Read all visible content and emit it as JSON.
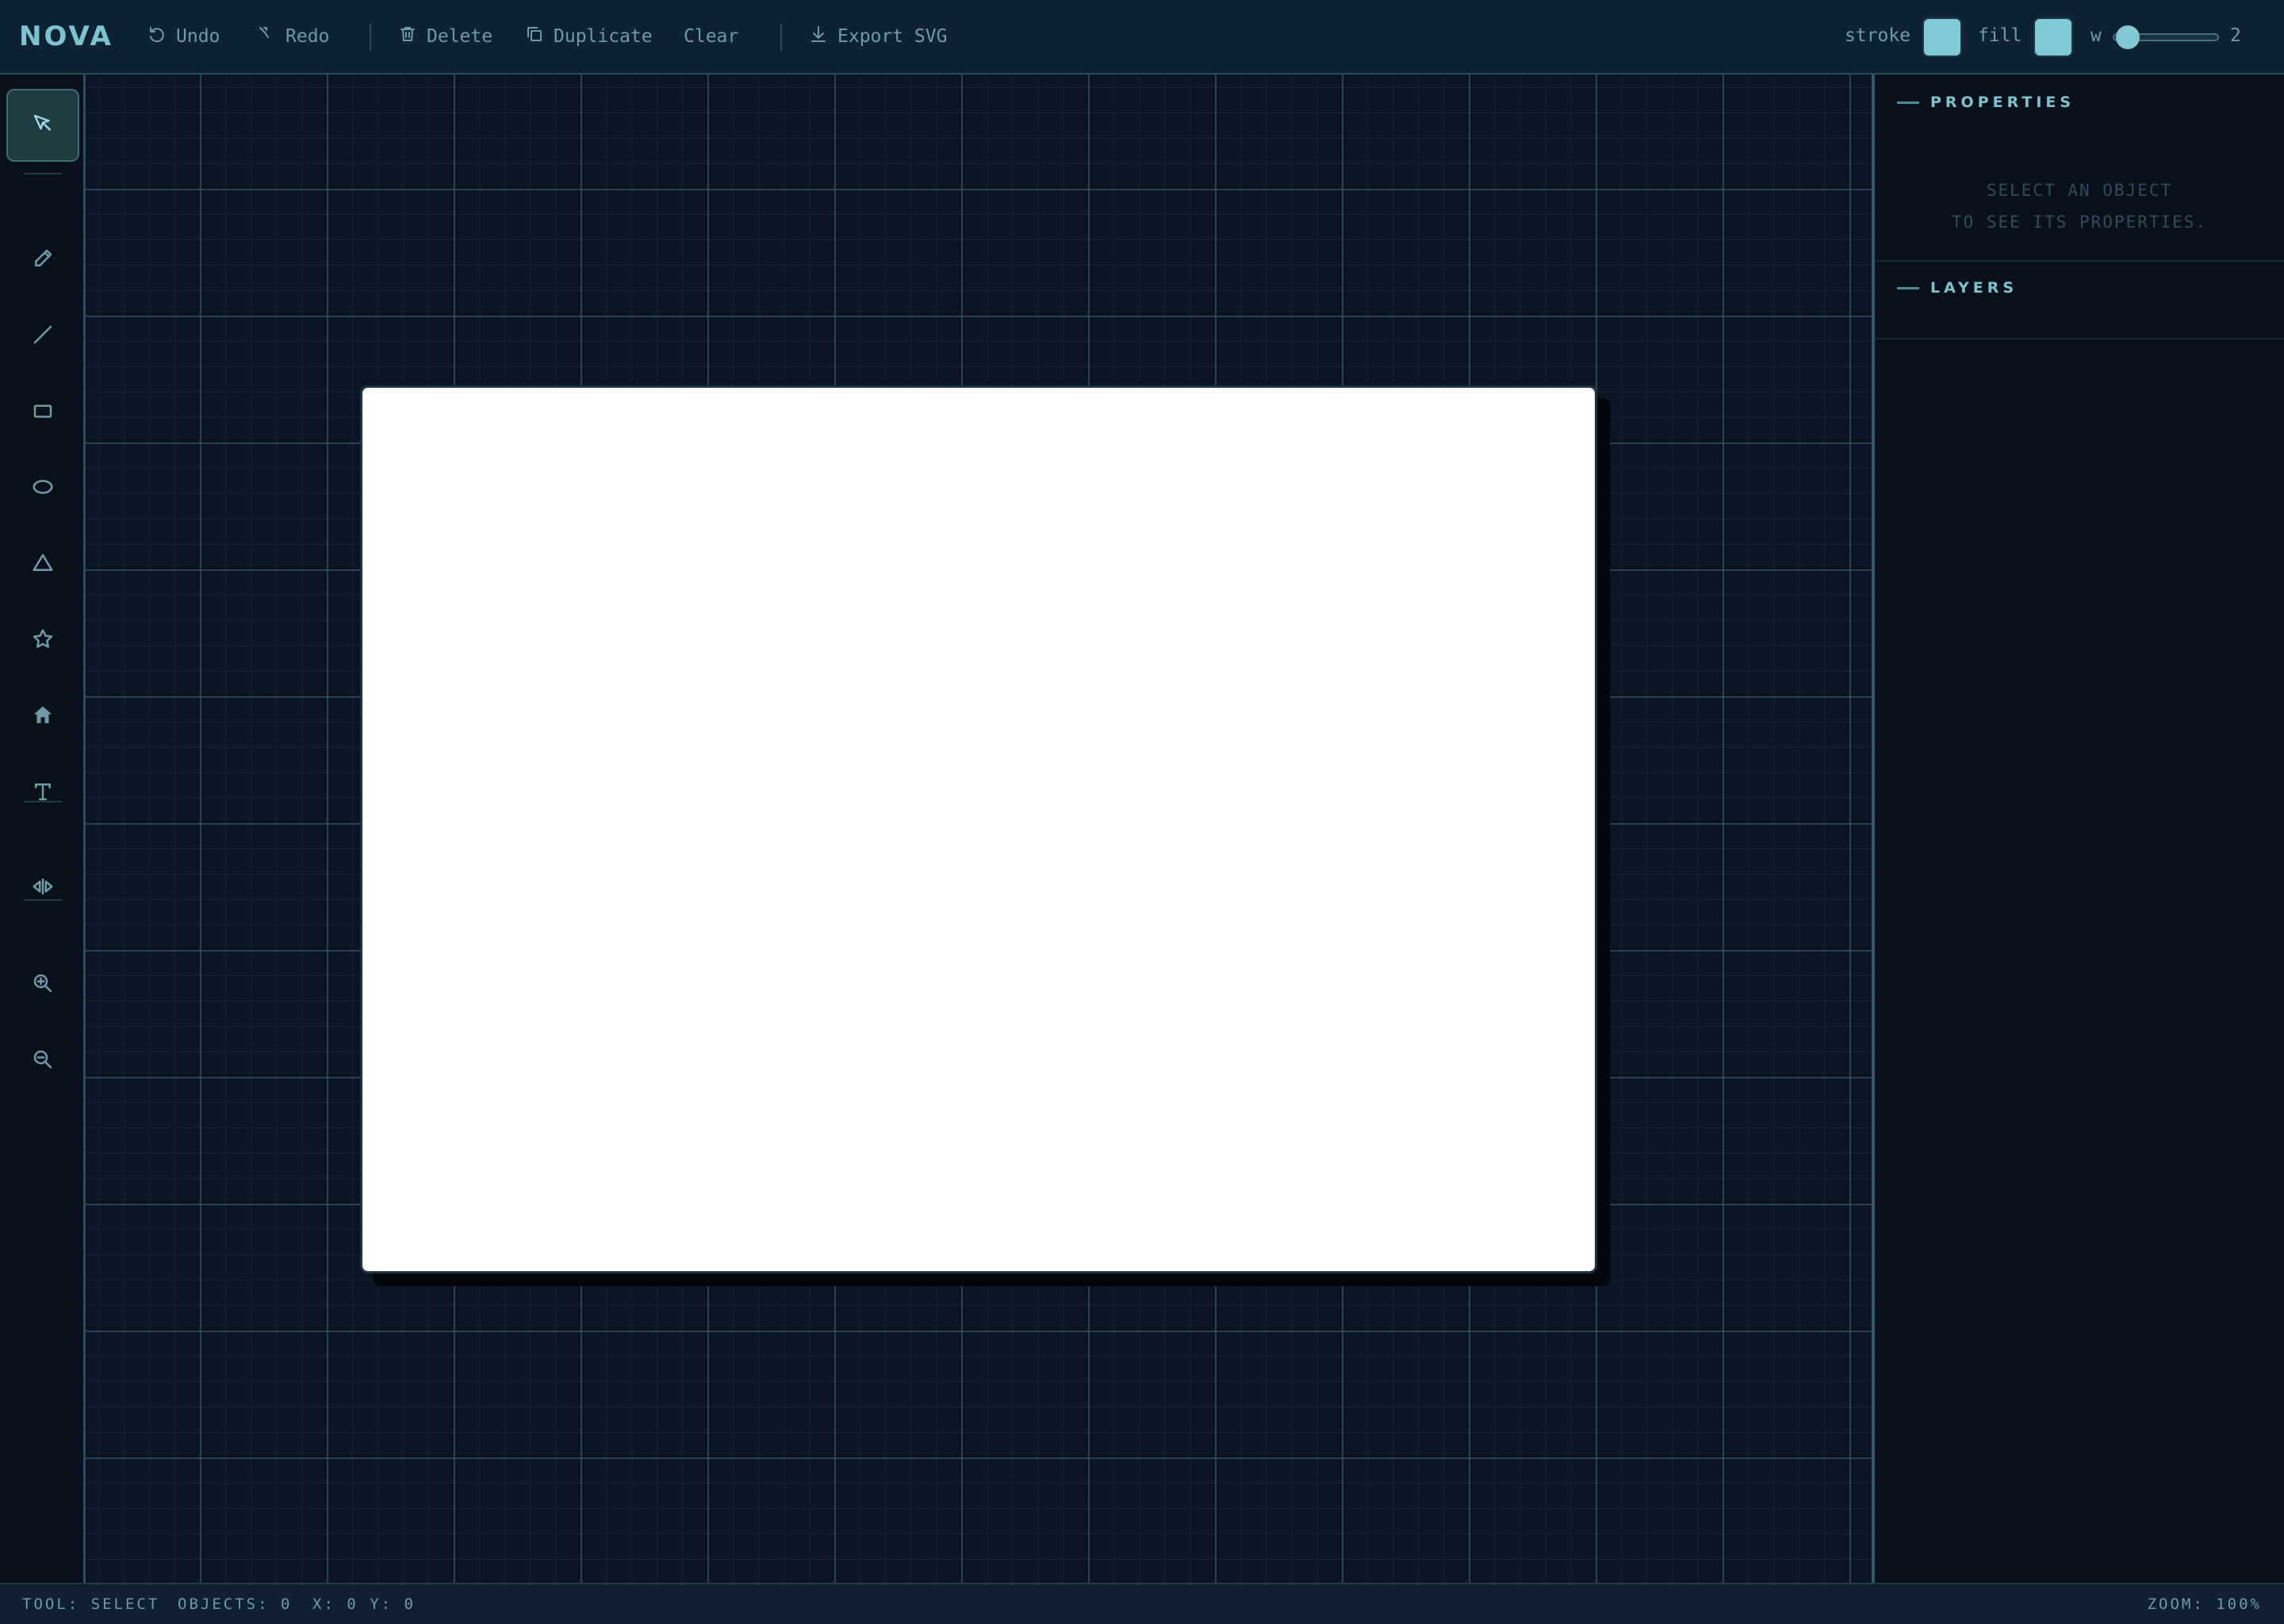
{
  "app": {
    "brand": "NOVA"
  },
  "toolbar": {
    "undo": "Undo",
    "redo": "Redo",
    "delete": "Delete",
    "duplicate": "Duplicate",
    "clear": "Clear",
    "export": "Export SVG",
    "stroke_label": "stroke",
    "fill_label": "fill",
    "width_label": "w",
    "width_value": "2",
    "stroke_color": "#82cbd6",
    "fill_color": "#82cbd6"
  },
  "tools": [
    {
      "name": "select",
      "icon": "cursor-arrow-icon",
      "active": true
    },
    {
      "name": "pencil",
      "icon": "pencil-icon",
      "active": false
    },
    {
      "name": "line",
      "icon": "line-icon",
      "active": false
    },
    {
      "name": "rectangle",
      "icon": "rectangle-icon",
      "active": false
    },
    {
      "name": "ellipse",
      "icon": "ellipse-icon",
      "active": false
    },
    {
      "name": "triangle",
      "icon": "triangle-icon",
      "active": false
    },
    {
      "name": "star",
      "icon": "star-icon",
      "active": false
    },
    {
      "name": "house",
      "icon": "house-icon",
      "active": false
    },
    {
      "name": "text",
      "icon": "text-icon",
      "active": false
    },
    {
      "name": "flip",
      "icon": "flip-horizontal-icon",
      "active": false
    },
    {
      "name": "zoom-in",
      "icon": "zoom-in-icon",
      "active": false
    },
    {
      "name": "zoom-out",
      "icon": "zoom-out-icon",
      "active": false
    }
  ],
  "panel": {
    "properties_title": "PROPERTIES",
    "empty_line1": "SELECT AN OBJECT",
    "empty_line2": "TO SEE ITS PROPERTIES.",
    "layers_title": "LAYERS"
  },
  "status": {
    "tool": "TOOL: SELECT",
    "objects": "OBJECTS: 0",
    "coords": "X: 0 Y: 0",
    "zoom": "ZOOM: 100%"
  },
  "colors": {
    "accent": "#7cc3cf",
    "background": "#0b1524",
    "panel": "#08111b",
    "artboard": "#ffffff"
  }
}
